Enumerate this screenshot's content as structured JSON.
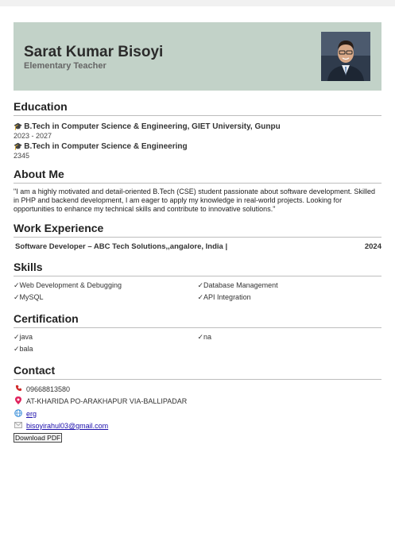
{
  "header": {
    "name": "Sarat Kumar Bisoyi",
    "role": "Elementary Teacher"
  },
  "education": {
    "heading": "Education",
    "items": [
      {
        "title": "B.Tech in Computer Science & Engineering, GIET University, Gunpu",
        "year": "2023 - 2027"
      },
      {
        "title": "B.Tech in Computer Science & Engineering",
        "year": "2345"
      }
    ]
  },
  "about": {
    "heading": "About Me",
    "text": "\"I am a highly motivated and detail-oriented B.Tech (CSE) student passionate about software development. Skilled in PHP and backend development, I am eager to apply my knowledge in real-world projects. Looking for opportunities to enhance my technical skills and contribute to innovative solutions.\""
  },
  "work": {
    "heading": "Work Experience",
    "title": "Software Developer – ABC Tech Solutions,,angalore, India |",
    "year": "2024"
  },
  "skills": {
    "heading": "Skills",
    "items": [
      "✓Web Development & Debugging",
      "✓Database Management",
      "✓MySQL",
      "✓API Integration"
    ]
  },
  "certification": {
    "heading": "Certification",
    "items": [
      "✓java",
      "✓na",
      "✓bala"
    ]
  },
  "contact": {
    "heading": "Contact",
    "phone": "09668813580",
    "address": "AT-KHARIDA PO-ARAKHAPUR VIA-BALLIPADAR",
    "website": "erg",
    "email": "bisoyirahul03@gmail.com"
  },
  "download_label": "Download PDF",
  "icons": {
    "education": "graduation-cap-icon",
    "phone": "phone-icon",
    "location": "location-pin-icon",
    "web": "globe-icon",
    "email": "envelope-icon"
  }
}
